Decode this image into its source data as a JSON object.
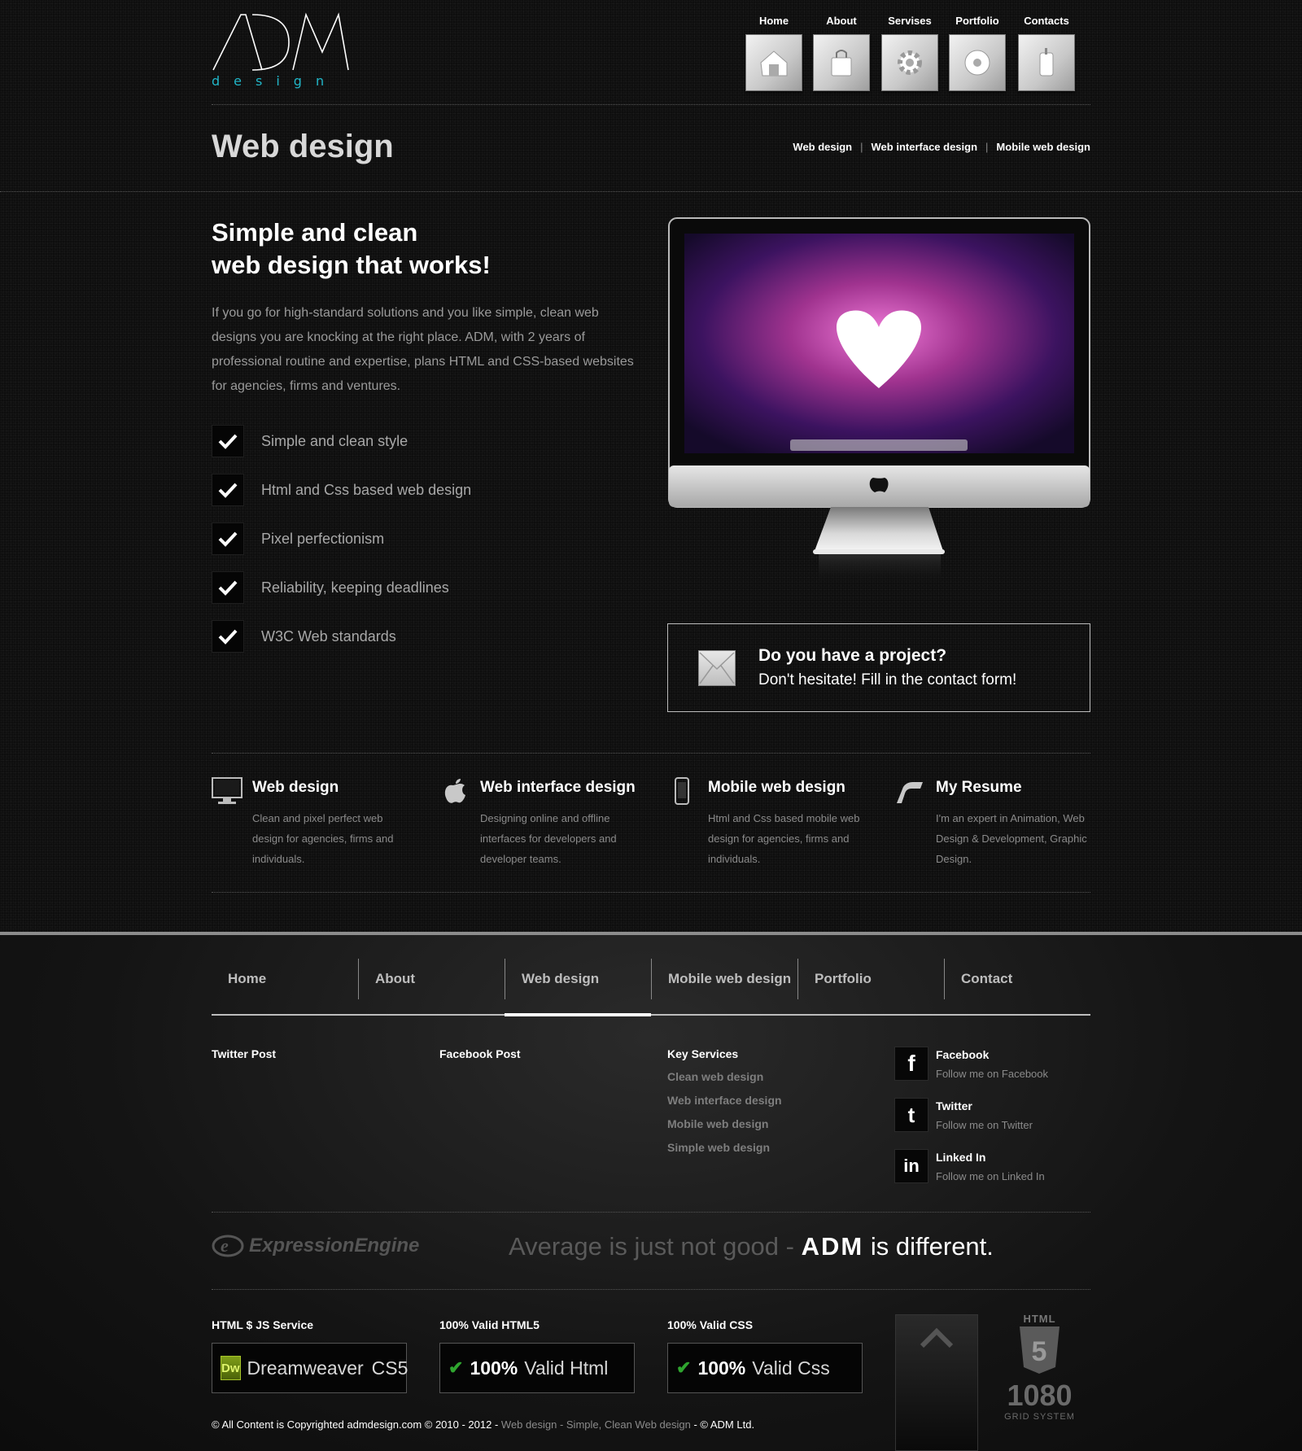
{
  "header": {
    "logo_text": "ADM",
    "logo_sub": "design",
    "nav": [
      {
        "label": "Home",
        "icon": "house-icon"
      },
      {
        "label": "About",
        "icon": "bag-icon"
      },
      {
        "label": "Servises",
        "icon": "gear-icon"
      },
      {
        "label": "Portfolio",
        "icon": "disc-icon"
      },
      {
        "label": "Contacts",
        "icon": "phone-icon"
      }
    ]
  },
  "page": {
    "title": "Web design",
    "crumbs": [
      "Web design",
      "Web interface design",
      "Mobile web design"
    ]
  },
  "hero": {
    "headline_1": "Simple and clean",
    "headline_2": "web design that works!",
    "intro": "If you go for high-standard solutions and you like simple, clean web designs you are knocking at the right place. ADM, with 2 years of professional routine and expertise, plans HTML and CSS-based websites for agencies, firms and ventures.",
    "checks": [
      "Simple and clean style",
      "Html and Css based web design",
      "Pixel perfectionism",
      "Reliability, keeping deadlines",
      "W3C Web standards"
    ],
    "contact_question": "Do you have a project?",
    "contact_sub": "Don't hesitate! Fill in the contact form!"
  },
  "services": [
    {
      "title": "Web design",
      "desc": "Clean and pixel perfect web design for agencies, firms and individuals.",
      "icon": "monitor-icon"
    },
    {
      "title": "Web interface design",
      "desc": "Designing online and offline interfaces for developers and developer teams.",
      "icon": "apple-icon"
    },
    {
      "title": "Mobile web design",
      "desc": "Html and Css based mobile web design for agencies, firms and individuals.",
      "icon": "mobile-icon"
    },
    {
      "title": "My Resume",
      "desc": "I'm an expert in Animation, Web Design & Development, Graphic Design.",
      "icon": "pen-icon"
    }
  ],
  "footer_nav": [
    "Home",
    "About",
    "Web design",
    "Mobile web design",
    "Portfolio",
    "Contact"
  ],
  "footer": {
    "twitter_title": "Twitter Post",
    "facebook_title": "Facebook Post",
    "key_title": "Key Services",
    "key_services": [
      "Clean web design",
      "Web interface design",
      "Mobile web design",
      "Simple web design"
    ],
    "social": [
      {
        "name": "Facebook",
        "sub": "Follow me on Facebook",
        "icon": "facebook-icon"
      },
      {
        "name": "Twitter",
        "sub": "Follow me on Twitter",
        "icon": "twitter-icon"
      },
      {
        "name": "Linked In",
        "sub": "Follow me on Linked In",
        "icon": "linkedin-icon"
      }
    ],
    "ee_text": "ExpressionEngine",
    "tag_a": "Average is just not good",
    "tag_dash": " - ",
    "tag_b": "ADM",
    "tag_c": " is different.",
    "badges": [
      {
        "label": "HTML $ JS Service",
        "text_a": "Dreamweaver",
        "text_b": "CS5",
        "icon_text": "Dw"
      },
      {
        "label": "100% Valid HTML5",
        "text_a": "100%",
        "text_b": "Valid Html"
      },
      {
        "label": "100% Valid CSS",
        "text_a": "100%",
        "text_b": "Valid Css"
      }
    ],
    "html5_top": "HTML",
    "html5_num": "1080",
    "html5_sub": "GRID SYSTEM",
    "copy_a": "© All Content is Copyrighted admdesign.com © 2010 - 2012 - ",
    "copy_b": "Web design",
    "copy_c": " - ",
    "copy_d": "Simple, Clean Web design",
    "copy_e": " - © ADM Ltd."
  },
  "colors": {
    "accent": "#21b6c8",
    "bg": "#0e0e0e",
    "check_green": "#2fa52f"
  }
}
